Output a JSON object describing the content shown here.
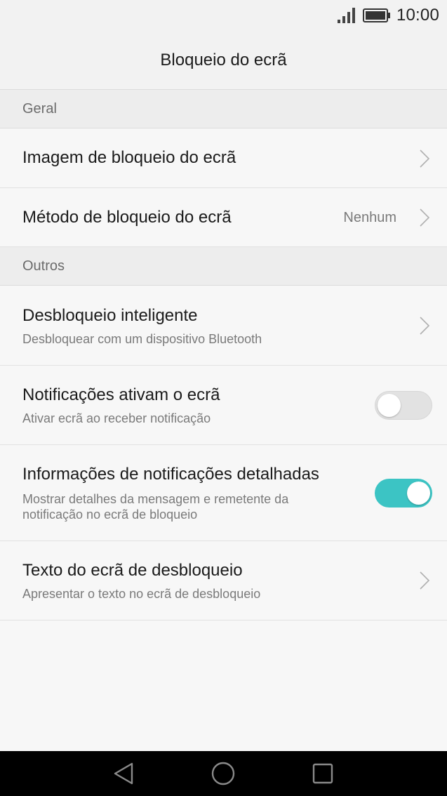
{
  "status_bar": {
    "time": "10:00",
    "icons": [
      "signal-icon",
      "battery-icon"
    ]
  },
  "header": {
    "title": "Bloqueio do ecrã"
  },
  "sections": [
    {
      "label": "Geral",
      "items": [
        {
          "title": "Imagem de bloqueio do ecrã",
          "control": "chevron"
        },
        {
          "title": "Método de bloqueio do ecrã",
          "value": "Nenhum",
          "control": "chevron"
        }
      ]
    },
    {
      "label": "Outros",
      "items": [
        {
          "title": "Desbloqueio inteligente",
          "subtitle": "Desbloquear com um dispositivo Bluetooth",
          "control": "chevron"
        },
        {
          "title": "Notificações ativam o ecrã",
          "subtitle": "Ativar ecrã ao receber notificação",
          "control": "toggle",
          "toggle_on": false
        },
        {
          "title": "Informações de notificações detalhadas",
          "subtitle": "Mostrar detalhes da mensagem e remetente da notificação no ecrã de bloqueio",
          "control": "toggle",
          "toggle_on": true
        },
        {
          "title": "Texto do ecrã de desbloqueio",
          "subtitle": "Apresentar o texto no ecrã de desbloqueio",
          "control": "chevron"
        }
      ]
    }
  ],
  "nav_bar": {
    "buttons": [
      "back-icon",
      "home-icon",
      "recents-icon"
    ]
  },
  "colors": {
    "accent": "#3cc4c4",
    "background": "#f7f7f7",
    "section_header": "#ededed",
    "nav_bar": "#000000"
  }
}
